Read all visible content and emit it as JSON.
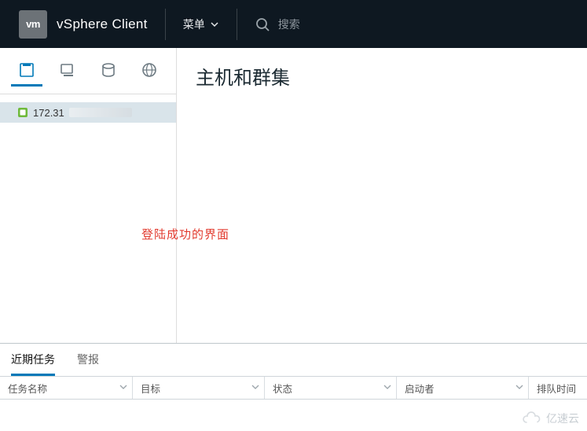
{
  "header": {
    "logo_text": "vm",
    "brand": "vSphere Client",
    "menu_label": "菜单",
    "search_placeholder": "搜索"
  },
  "sidebar": {
    "tabs": [
      {
        "name": "hosts-clusters",
        "active": true
      },
      {
        "name": "vms-templates",
        "active": false
      },
      {
        "name": "storage",
        "active": false
      },
      {
        "name": "networking",
        "active": false
      }
    ],
    "tree": {
      "items": [
        {
          "label": "172.31",
          "type": "vcenter",
          "selected": true
        }
      ]
    }
  },
  "content": {
    "title": "主机和群集"
  },
  "annotation": {
    "note": "登陆成功的界面"
  },
  "bottom_panel": {
    "tabs": [
      {
        "label": "近期任务",
        "active": true
      },
      {
        "label": "警报",
        "active": false
      }
    ],
    "columns": [
      {
        "label": "任务名称"
      },
      {
        "label": "目标"
      },
      {
        "label": "状态"
      },
      {
        "label": "启动者"
      },
      {
        "label": "排队时间"
      }
    ]
  },
  "watermark": {
    "text": "亿速云"
  }
}
